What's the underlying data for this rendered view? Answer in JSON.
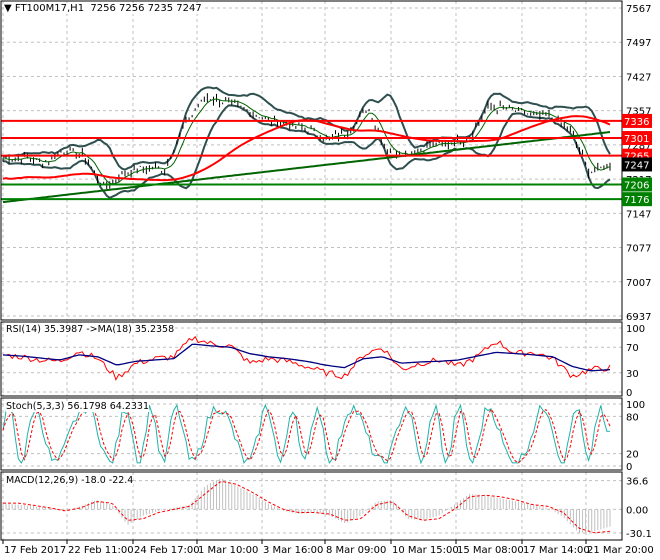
{
  "header": {
    "symbol": "FT100M17,H1",
    "ohlc": "7256 7256 7235 7247"
  },
  "colors": {
    "up_line": "#ff0000",
    "support": "#008000",
    "ma_slow": "#006400",
    "ma_fast": "#ff0000",
    "rsi": "#ff0000",
    "rsi_ma": "#000080",
    "stoch_main": "#20b2aa",
    "stoch_signal": "#ff0000",
    "macd_hist": "#c0c0c0",
    "macd_signal": "#ff0000"
  },
  "chart_data": [
    {
      "type": "line",
      "title": "FT100M17,H1",
      "ylim": [
        6937,
        7567
      ],
      "yticks": [
        7567,
        7497,
        7427,
        7357,
        7287,
        7217,
        7147,
        7077,
        7007,
        6937
      ],
      "xticks": [
        "17 Feb 2017",
        "22 Feb 11:00",
        "24 Feb 17:00",
        "1 Mar 10:00",
        "3 Mar 16:00",
        "8 Mar 09:00",
        "10 Mar 15:00",
        "15 Mar 08:00",
        "17 Mar 14:00",
        "21 Mar 20:00"
      ],
      "levels": [
        {
          "value": 7336,
          "label": "7336",
          "color": "red"
        },
        {
          "value": 7301,
          "label": "7301",
          "color": "red"
        },
        {
          "value": 7265,
          "label": "7265",
          "color": "red"
        },
        {
          "value": 7206,
          "label": "7206",
          "color": "green"
        },
        {
          "value": 7176,
          "label": "7176",
          "color": "green"
        }
      ],
      "current": {
        "value": 7247,
        "label": "7247"
      },
      "close_keypoints": [
        7258,
        7262,
        7250,
        7275,
        7265,
        7200,
        7230,
        7240,
        7238,
        7330,
        7385,
        7375,
        7360,
        7340,
        7330,
        7320,
        7300,
        7310,
        7365,
        7275,
        7270,
        7285,
        7290,
        7300,
        7365,
        7360,
        7350,
        7345,
        7320,
        7230,
        7247
      ]
    },
    {
      "type": "line",
      "title": "RSI(14) 35.3987  ->MA(18) 35.2358",
      "ylim": [
        0,
        100
      ],
      "yticks": [
        100,
        70,
        30,
        0
      ],
      "rsi_keypoints": [
        58,
        55,
        50,
        48,
        64,
        52,
        22,
        45,
        52,
        55,
        85,
        75,
        72,
        45,
        52,
        48,
        40,
        30,
        25,
        58,
        70,
        35,
        45,
        50,
        40,
        55,
        80,
        60,
        62,
        52,
        25,
        35,
        38
      ],
      "ma_keypoints": [
        58,
        56,
        53,
        50,
        58,
        55,
        42,
        48,
        50,
        52,
        75,
        72,
        70,
        60,
        55,
        52,
        48,
        42,
        38,
        52,
        55,
        45,
        47,
        48,
        50,
        56,
        62,
        60,
        58,
        55,
        40,
        33,
        35
      ]
    },
    {
      "type": "line",
      "title": "Stoch(5,3,3) 56.1798 64.2331",
      "ylim": [
        0,
        100
      ],
      "yticks": [
        100,
        80,
        20,
        0
      ],
      "main": 56.1798,
      "signal": 64.2331
    },
    {
      "type": "bar",
      "title": "MACD(12,26,9) -18.0 -22.4",
      "yticks": [
        36.6,
        0.0,
        -30.1
      ],
      "hist_keypoints": [
        8,
        6,
        4,
        2,
        -2,
        4,
        12,
        6,
        -20,
        -8,
        -2,
        2,
        6,
        30,
        40,
        30,
        20,
        8,
        -2,
        -6,
        -4,
        -8,
        -18,
        -8,
        10,
        12,
        -12,
        -14,
        -8,
        6,
        20,
        18,
        14,
        10,
        6,
        2,
        -10,
        -30,
        -28,
        -22
      ],
      "signal_keypoints": [
        8,
        8,
        5,
        2,
        -2,
        2,
        10,
        8,
        -14,
        -12,
        -4,
        0,
        4,
        20,
        36,
        32,
        22,
        10,
        0,
        -4,
        -4,
        -6,
        -14,
        -12,
        6,
        10,
        -8,
        -14,
        -12,
        0,
        16,
        18,
        16,
        12,
        6,
        4,
        -4,
        -24,
        -30,
        -28
      ]
    }
  ]
}
